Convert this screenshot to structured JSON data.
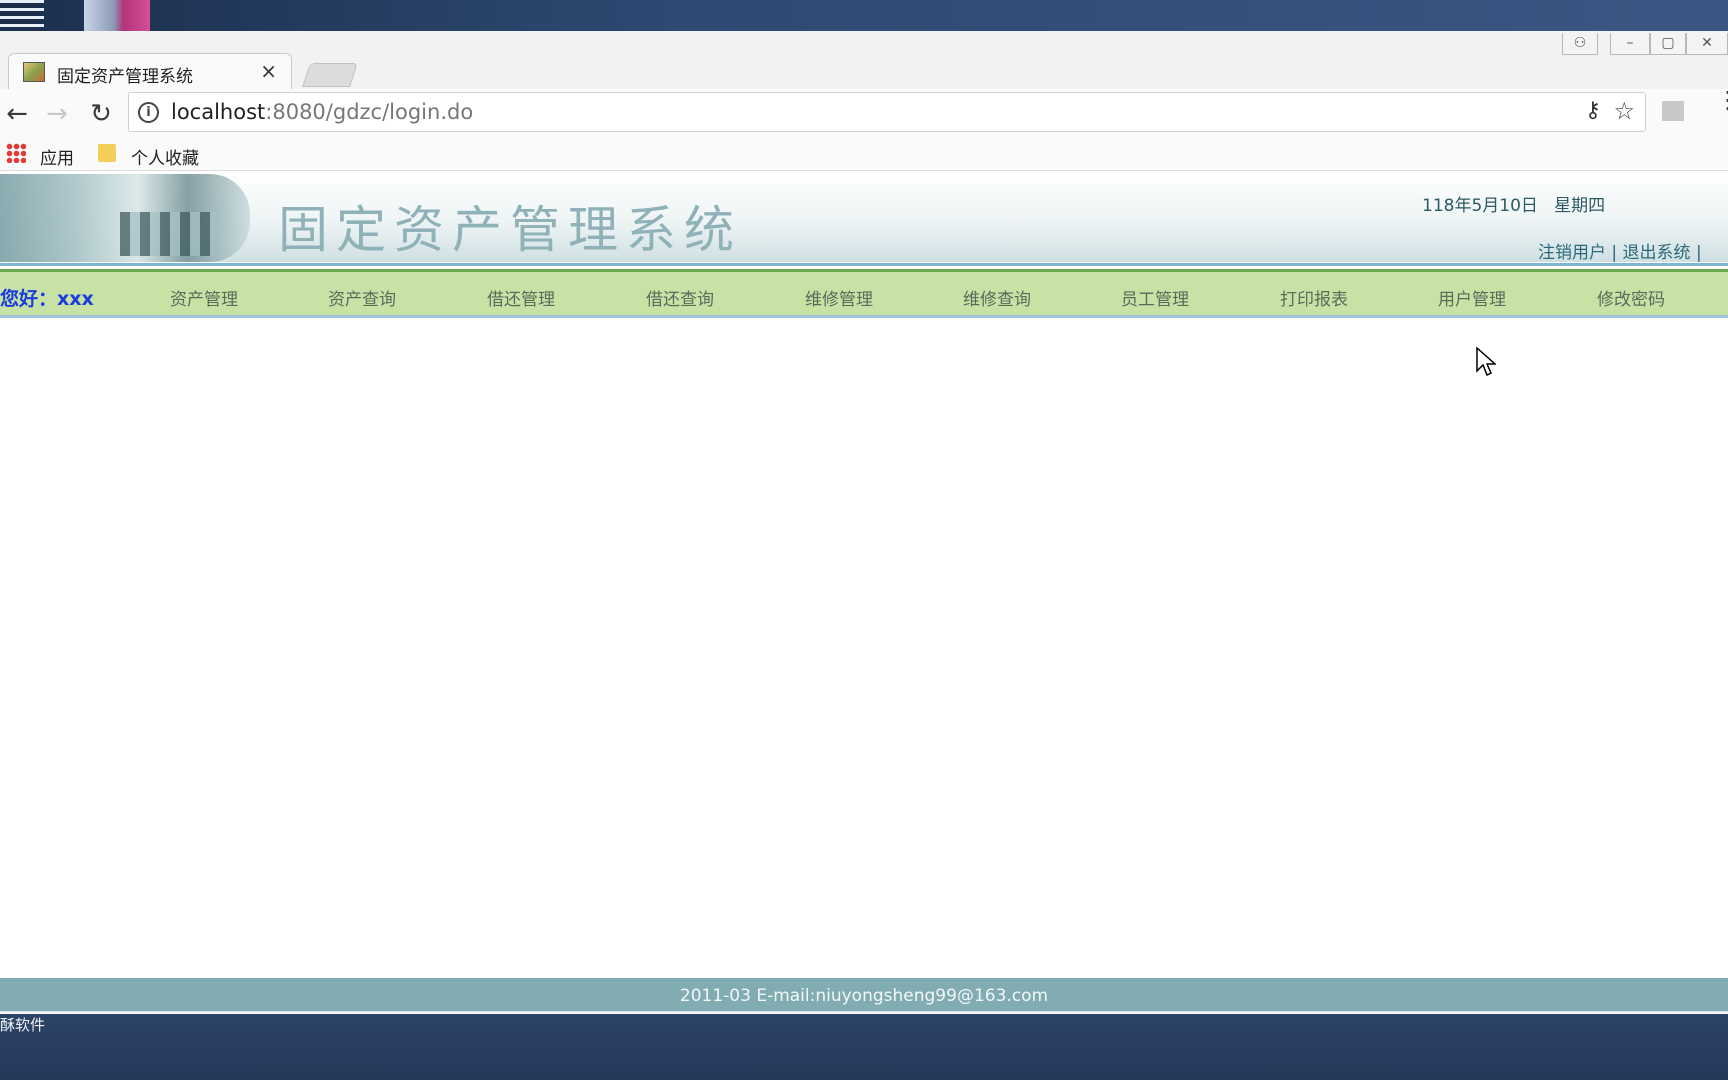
{
  "tab": {
    "title": "固定资产管理系统",
    "close": "×"
  },
  "window_controls": {
    "profile": "⚇",
    "minimize": "–",
    "maximize": "▢",
    "close": "✕"
  },
  "toolbar": {
    "back": "←",
    "forward": "→",
    "reload": "↻",
    "url_host": "localhost",
    "url_path": ":8080/gdzc/login.do",
    "key": "⚷",
    "star": "☆",
    "menu": "⋮"
  },
  "bookmarks": {
    "apps": "应用",
    "folder": "个人收藏"
  },
  "banner": {
    "title": "固定资产管理系统",
    "date": "118年5月10日",
    "weekday": "星期四",
    "logout_user": "注销用户",
    "sep1": " | ",
    "exit": "退出系统",
    "sep2": " |"
  },
  "navbar": {
    "greeting": "您好：xxx",
    "items": [
      "资产管理",
      "资产查询",
      "借还管理",
      "借还查询",
      "维修管理",
      "维修查询",
      "员工管理",
      "打印报表",
      "用户管理",
      "修改密码"
    ]
  },
  "footer": {
    "text": "2011-03 E-mail:niuyongsheng99@163.com"
  },
  "taskbar": {
    "label": "酥软件"
  }
}
